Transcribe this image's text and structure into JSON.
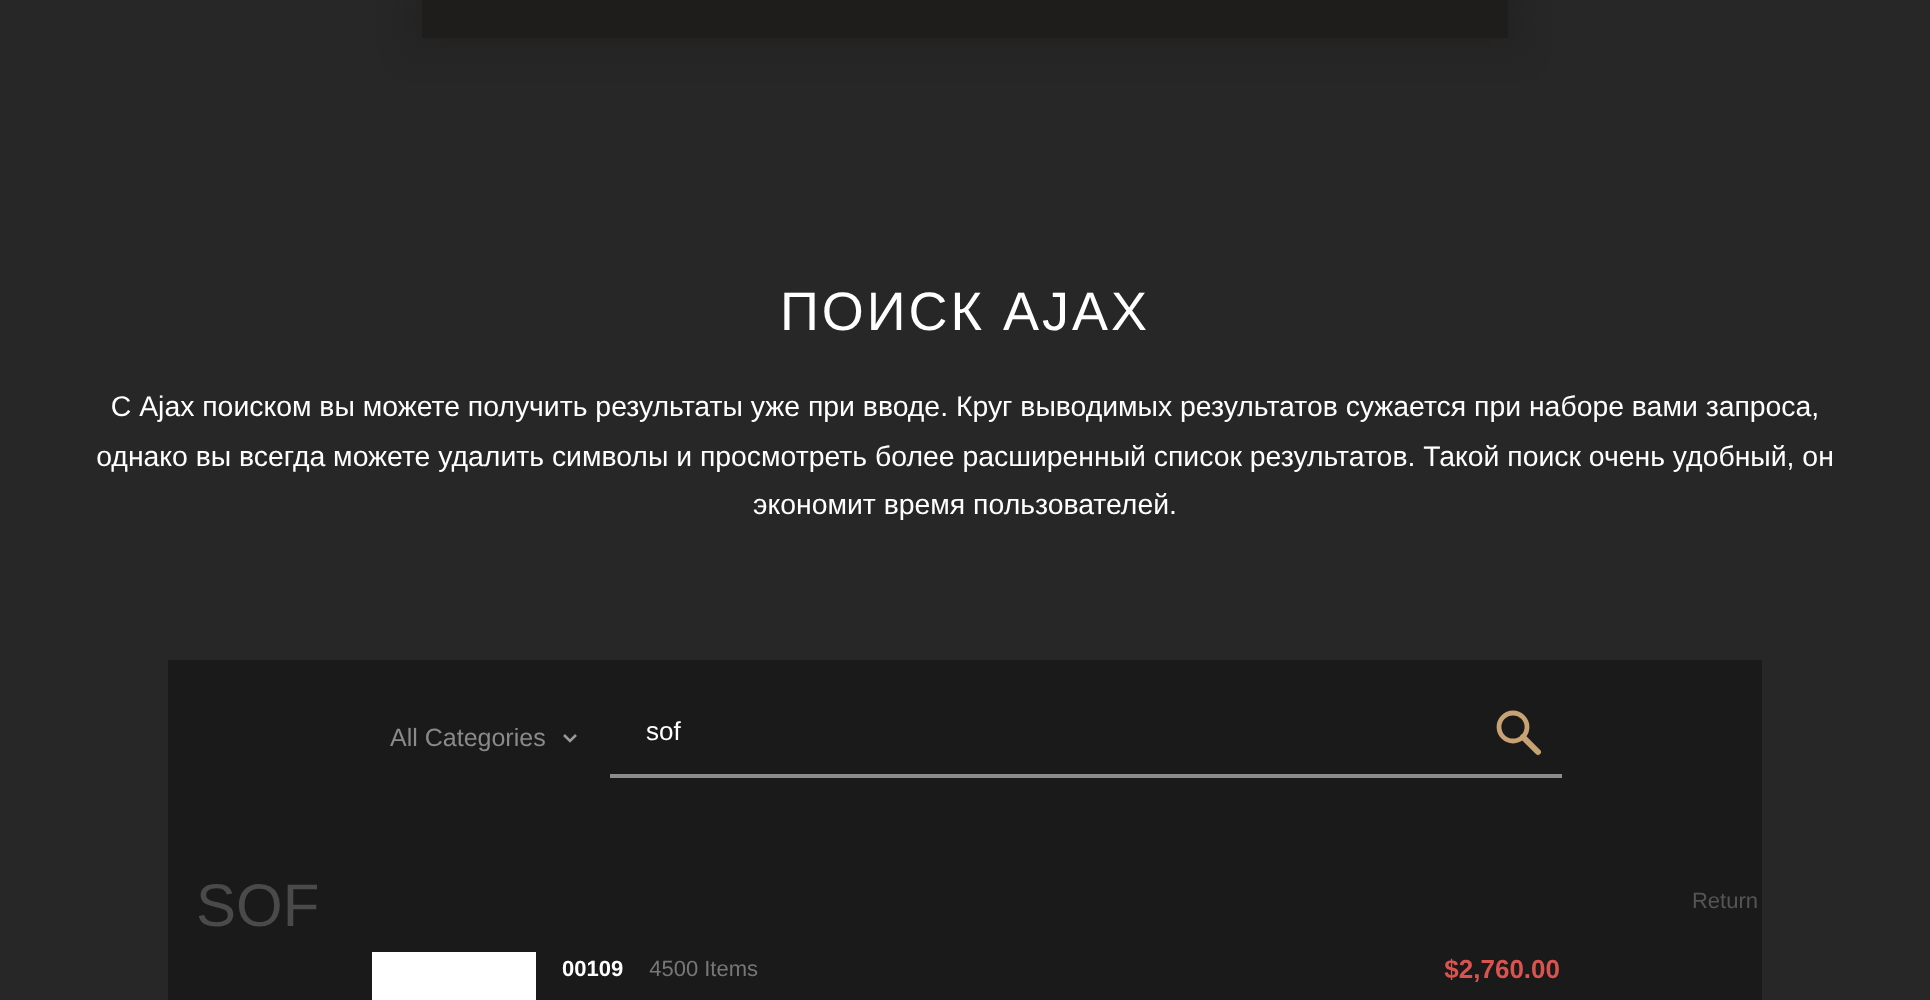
{
  "section": {
    "title": "ПОИСК AJAX",
    "description": "С Ajax поиском вы можете получить результаты уже при вводе. Круг выводимых результатов сужается при наборе вами запроса, однако вы всегда можете удалить символы и просмотреть более расширенный список результатов. Такой поиск очень удобный, он экономит время пользователей."
  },
  "search": {
    "category": "All Categories",
    "value": "sof",
    "background_text": "SOF",
    "side_text": "Return"
  },
  "results": [
    {
      "code": "00109",
      "count": "4500 Items",
      "price": "$2,760.00"
    }
  ]
}
